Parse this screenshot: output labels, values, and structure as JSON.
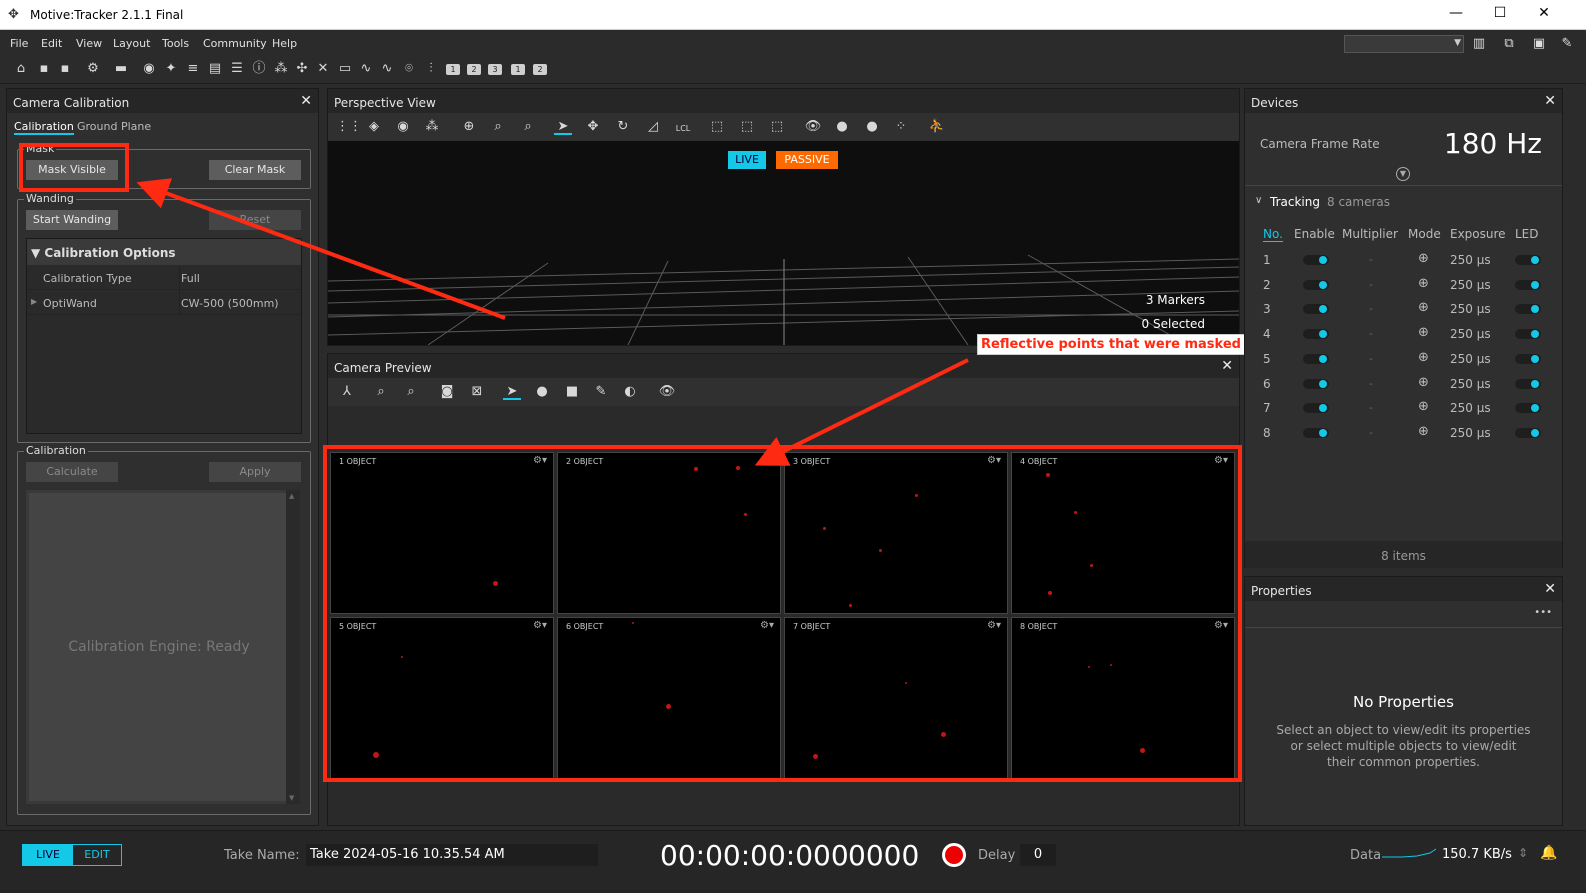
{
  "window": {
    "title": "Motive:Tracker 2.1.1 Final",
    "min": "—",
    "max": "☐",
    "close": "✕"
  },
  "menu": [
    "File",
    "Edit",
    "View",
    "Layout",
    "Tools",
    "Community",
    "Help"
  ],
  "toolbar_numbers": [
    "1",
    "2",
    "3",
    "1",
    "2"
  ],
  "calibration": {
    "title": "Camera Calibration",
    "close": "✕",
    "tabs": [
      "Calibration",
      "Ground Plane"
    ],
    "mask_legend": "Mask",
    "mask_visible": "Mask Visible",
    "clear_mask": "Clear Mask",
    "wanding_legend": "Wanding",
    "start_wanding": "Start Wanding",
    "reset": "Reset",
    "options_header": "Calibration Options",
    "options_rows": [
      {
        "label": "Calibration Type",
        "value": "Full"
      },
      {
        "label": "OptiWand",
        "value": "CW-500 (500mm)"
      }
    ],
    "calib_legend": "Calibration",
    "calculate": "Calculate",
    "apply": "Apply",
    "engine_status": "Calibration Engine: Ready"
  },
  "perspective": {
    "title": "Perspective View",
    "live": "LIVE",
    "passive": "PASSIVE",
    "markers": "3 Markers",
    "selected": "0 Selected",
    "lcl": "LCL"
  },
  "annotation": {
    "label": "Reflective points that were masked"
  },
  "preview": {
    "title": "Camera Preview",
    "close": "✕",
    "cameras": [
      {
        "num": "1",
        "tag": "OBJECT"
      },
      {
        "num": "2",
        "tag": "OBJECT"
      },
      {
        "num": "3",
        "tag": "OBJECT"
      },
      {
        "num": "4",
        "tag": "OBJECT"
      },
      {
        "num": "5",
        "tag": "OBJECT"
      },
      {
        "num": "6",
        "tag": "OBJECT"
      },
      {
        "num": "7",
        "tag": "OBJECT"
      },
      {
        "num": "8",
        "tag": "OBJECT"
      }
    ]
  },
  "devices": {
    "title": "Devices",
    "close": "✕",
    "frame_rate_label": "Camera Frame Rate",
    "frame_rate_value": "180 Hz",
    "tracking": "Tracking",
    "cameras_count": "8 cameras",
    "headers": [
      "No.",
      "Enable",
      "Multiplier",
      "Mode",
      "Exposure",
      "LED"
    ],
    "rows": [
      {
        "no": "1",
        "mult": "-",
        "exp": "250 µs"
      },
      {
        "no": "2",
        "mult": "-",
        "exp": "250 µs"
      },
      {
        "no": "3",
        "mult": "-",
        "exp": "250 µs"
      },
      {
        "no": "4",
        "mult": "-",
        "exp": "250 µs"
      },
      {
        "no": "5",
        "mult": "-",
        "exp": "250 µs"
      },
      {
        "no": "6",
        "mult": "-",
        "exp": "250 µs"
      },
      {
        "no": "7",
        "mult": "-",
        "exp": "250 µs"
      },
      {
        "no": "8",
        "mult": "-",
        "exp": "250 µs"
      }
    ],
    "items_count": "8 items"
  },
  "properties": {
    "title": "Properties",
    "close": "✕",
    "more": "•••",
    "empty_title": "No Properties",
    "empty_text_1": "Select an object to view/edit its properties",
    "empty_text_2": "or select multiple objects to view/edit",
    "empty_text_3": "their common properties."
  },
  "statusbar": {
    "live": "LIVE",
    "edit": "EDIT",
    "take_label": "Take Name:",
    "take_value": "Take 2024-05-16 10.35.54 AM",
    "timecode": "00:00:00:000",
    "frame": "0000",
    "delay_label": "Delay",
    "delay_value": "0",
    "data_label": "Data",
    "data_rate": "150.7 KB/s"
  },
  "colors": {
    "accent": "#14c8e8",
    "annotation": "#ff2a12",
    "passive": "#ff6a00",
    "marker": "#c21515"
  }
}
